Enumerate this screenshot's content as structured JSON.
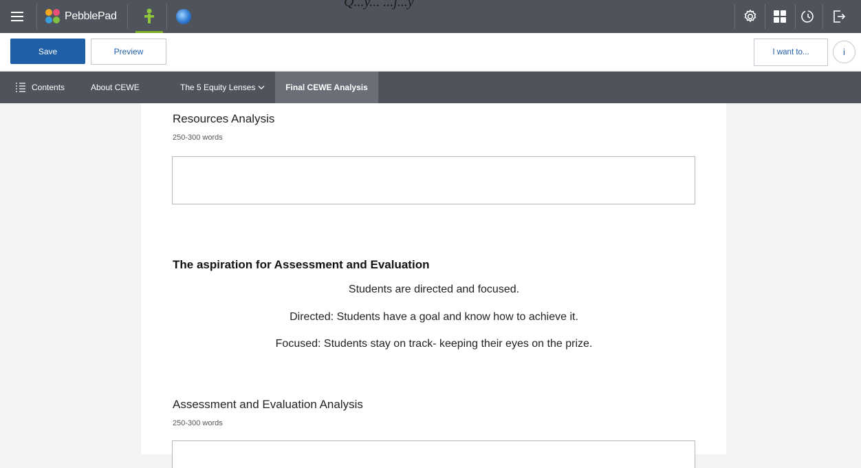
{
  "top_title": "Q...y... ...j...y",
  "brand": {
    "name": "PebblePad"
  },
  "icons": {
    "menu": "hamburger-menu-icon",
    "brand_logo": "pebblepad-logo-icon",
    "person": "person-icon",
    "globe": "globe-icon",
    "settings": "gear-icon",
    "apps": "grid-icon",
    "history": "history-icon",
    "logout": "logout-icon",
    "contents": "contents-list-icon",
    "dropdown": "chevron-down-icon"
  },
  "colors": {
    "topbar": "#4f545c",
    "accent_blue": "#1f5fa8",
    "active_green": "#7fae23"
  },
  "toolbar": {
    "save_label": "Save",
    "preview_label": "Preview",
    "i_want_to_label": "I want to...",
    "info_label": "i"
  },
  "nav": {
    "contents_label": "Contents",
    "about_label": "About CEWE",
    "lenses_label": "The 5 Equity Lenses",
    "final_label": "Final CEWE Analysis"
  },
  "main": {
    "resources": {
      "title": "Resources Analysis",
      "hint": "250-300 words",
      "value": ""
    },
    "aspiration": {
      "heading": "The aspiration for Assessment and Evaluation",
      "lines": [
        "Students are directed and focused.",
        "Directed: Students have a goal and know how to achieve it.",
        "Focused: Students stay on track- keeping their eyes on the prize."
      ]
    },
    "assessment": {
      "title": "Assessment and Evaluation Analysis",
      "hint": "250-300 words",
      "value": ""
    }
  }
}
